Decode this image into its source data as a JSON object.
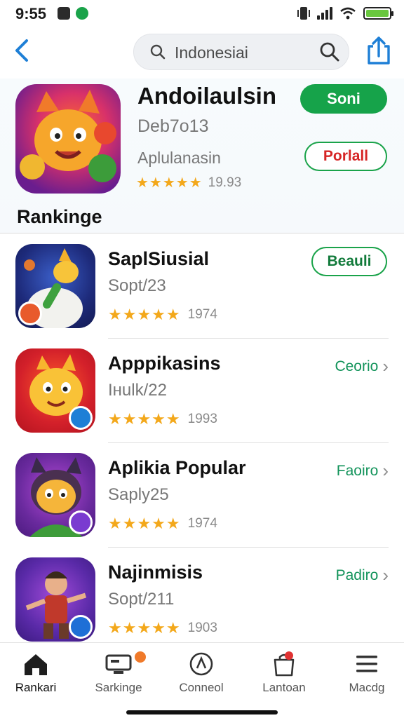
{
  "status_bar": {
    "time": "9:55"
  },
  "header": {
    "search_value": "Indonesiai"
  },
  "featured": {
    "title": "Andoilaulsin",
    "subtitle": "Deb7o13",
    "category": "Aplulanasin",
    "stars": "★★★★★",
    "rating_count": "19.93",
    "get_label": "Soni",
    "more_label": "Porlall"
  },
  "section_title": "Rankinge",
  "apps": [
    {
      "name": "SaplSiusial",
      "meta": "Sopt/23",
      "stars": "★★★★★",
      "rating_count": "1974",
      "action": "Beauli"
    },
    {
      "name": "Apppikasins",
      "meta": "Iнulk/22",
      "stars": "★★★★★",
      "rating_count": "1993",
      "action": "Ceorio"
    },
    {
      "name": "Aplikia Popular",
      "meta": "Saply25",
      "stars": "★★★★★",
      "rating_count": "1974",
      "action": "Faoiro"
    },
    {
      "name": "Najinmisis",
      "meta": "Sopt/211",
      "stars": "★★★★★",
      "rating_count": "1903",
      "action": "Padiro"
    }
  ],
  "tabs": [
    {
      "label": "Rankari"
    },
    {
      "label": "Sarkinge"
    },
    {
      "label": "Conneol"
    },
    {
      "label": "Lantoan"
    },
    {
      "label": "Macdg"
    }
  ],
  "colors": {
    "accent_green": "#16a34a",
    "star": "#f3a81b",
    "link_green": "#12935a",
    "brand_blue": "#1e7fd6"
  },
  "icons": [
    "back-chevron-icon",
    "search-icon",
    "share-icon",
    "home-icon",
    "rankings-icon",
    "connect-icon",
    "bag-icon",
    "menu-icon"
  ]
}
